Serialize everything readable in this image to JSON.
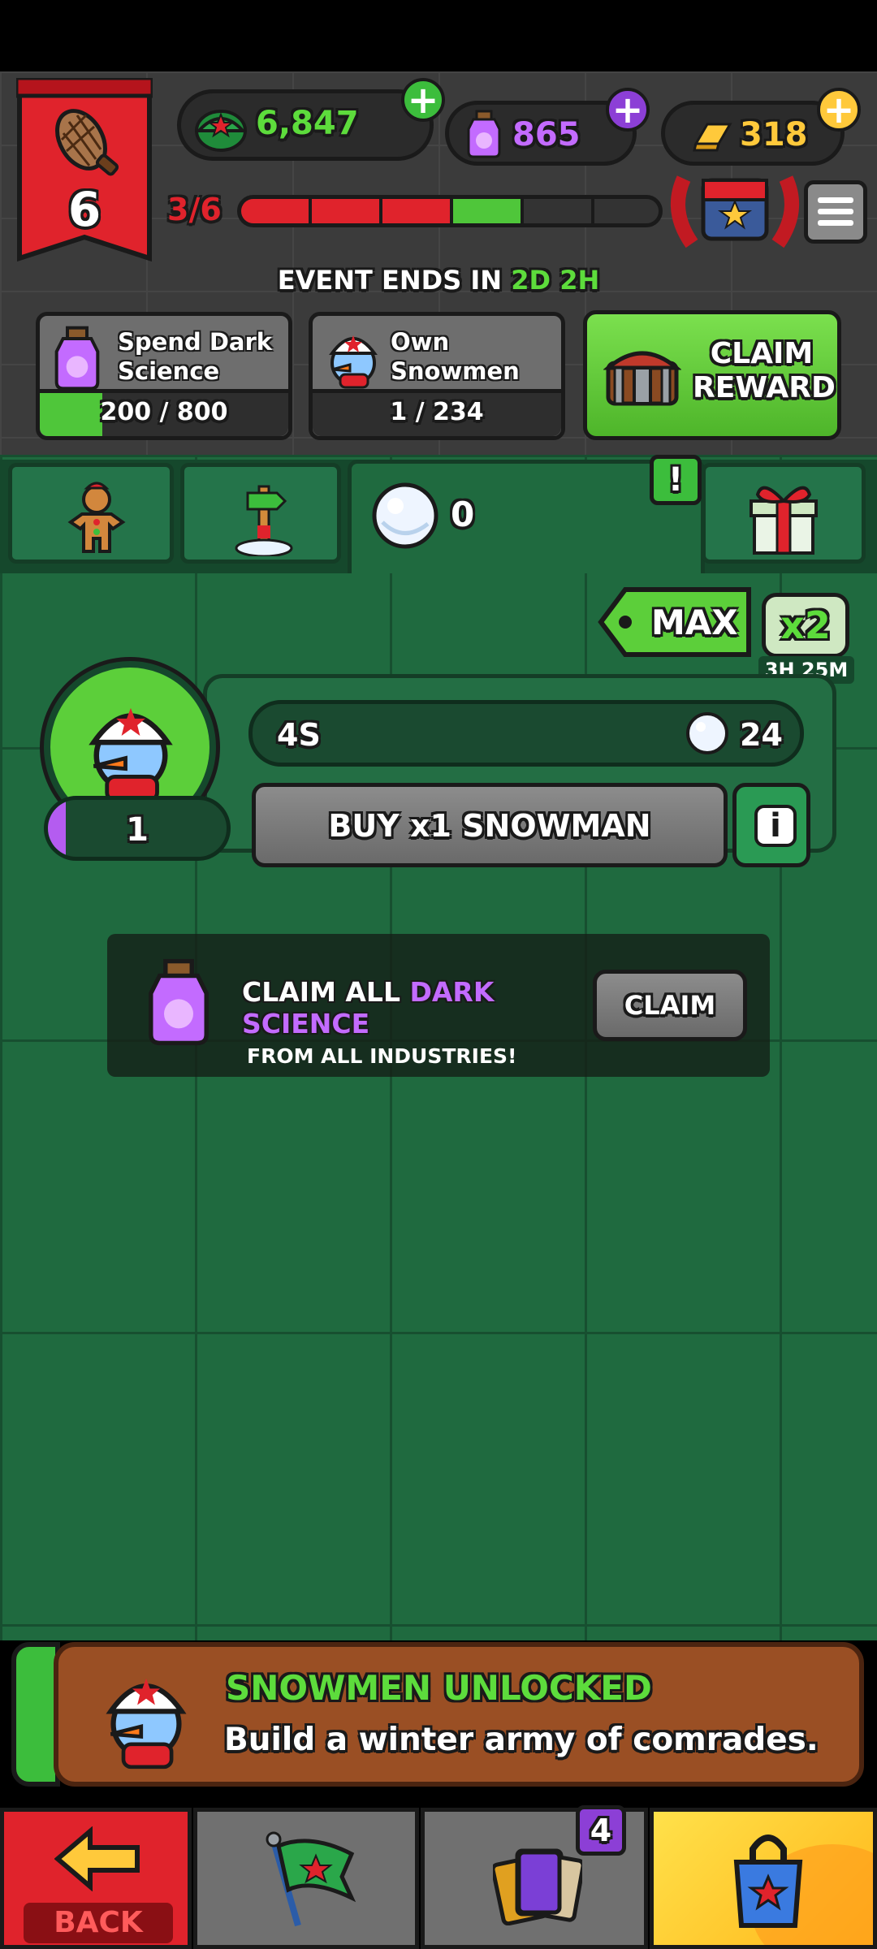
{
  "level": {
    "number": "6",
    "progress_text": "3/6"
  },
  "currencies": {
    "green_value": "6,847",
    "science_value": "865",
    "gold_value": "318"
  },
  "event": {
    "ends_prefix": "EVENT ENDS IN",
    "ends_time": "2D 2H"
  },
  "tasks": [
    {
      "title": "Spend Dark Science",
      "progress": "200 / 800",
      "fill": 0.25
    },
    {
      "title": "Own Snowmen",
      "progress": "1 / 234",
      "fill": 0.0
    }
  ],
  "claim_reward": {
    "label": "CLAIM REWARD"
  },
  "tabs": {
    "snowball_count": "0",
    "alert": "!"
  },
  "multiplier": {
    "max_label": "MAX",
    "x2_label": "x2",
    "timer": "3H 25M"
  },
  "production": {
    "timer": "4S",
    "reward": "24",
    "owned": "1",
    "buy_label": "BUY x1 SNOWMAN",
    "info_label": "i"
  },
  "claim_all": {
    "line1_a": "CLAIM ALL",
    "line1_b": "DARK SCIENCE",
    "line2": "FROM ALL INDUSTRIES!",
    "button": "CLAIM"
  },
  "banner": {
    "title": "SNOWMEN UNLOCKED",
    "subtitle": "Build a winter army of comrades."
  },
  "nav": {
    "back_label": "BACK",
    "cards_badge": "4"
  },
  "colors": {
    "accent_green": "#5ddc3c",
    "science_purple": "#c36bff",
    "gold": "#ffc93b",
    "banner_red": "#e0232c"
  }
}
